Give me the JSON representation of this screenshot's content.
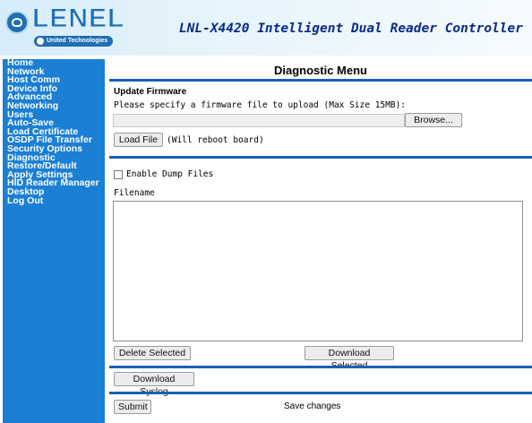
{
  "header": {
    "logo_text": "LENEL",
    "logo_sub": "United Technologies",
    "product_title": "LNL-X4420 Intelligent Dual Reader Controller"
  },
  "sidebar": {
    "items": [
      {
        "label": "Home"
      },
      {
        "label": "Network"
      },
      {
        "label": "Host Comm"
      },
      {
        "label": "Device Info"
      },
      {
        "label": "Advanced Networking"
      },
      {
        "label": "Users"
      },
      {
        "label": "Auto-Save"
      },
      {
        "label": "Load Certificate"
      },
      {
        "label": "OSDP File Transfer"
      },
      {
        "label": "Security Options"
      },
      {
        "label": "Diagnostic"
      },
      {
        "label": "Restore/Default"
      },
      {
        "label": "Apply Settings"
      },
      {
        "label": "HID Reader Manager Desktop"
      },
      {
        "label": "Log Out"
      }
    ]
  },
  "main": {
    "page_title": "Diagnostic Menu",
    "firmware": {
      "heading": "Update Firmware",
      "instruction": "Please specify a firmware file to upload (Max Size 15MB):",
      "browse_label": "Browse...",
      "load_label": "Load File",
      "reboot_note": "(Will reboot board)"
    },
    "dump": {
      "checkbox_label": "Enable Dump Files",
      "checked": false,
      "filename_heading": "Filename",
      "delete_label": "Delete Selected",
      "download_label": "Download Selected"
    },
    "syslog": {
      "download_label": "Download Syslog"
    },
    "footer": {
      "submit_label": "Submit",
      "save_text": "Save changes"
    }
  }
}
